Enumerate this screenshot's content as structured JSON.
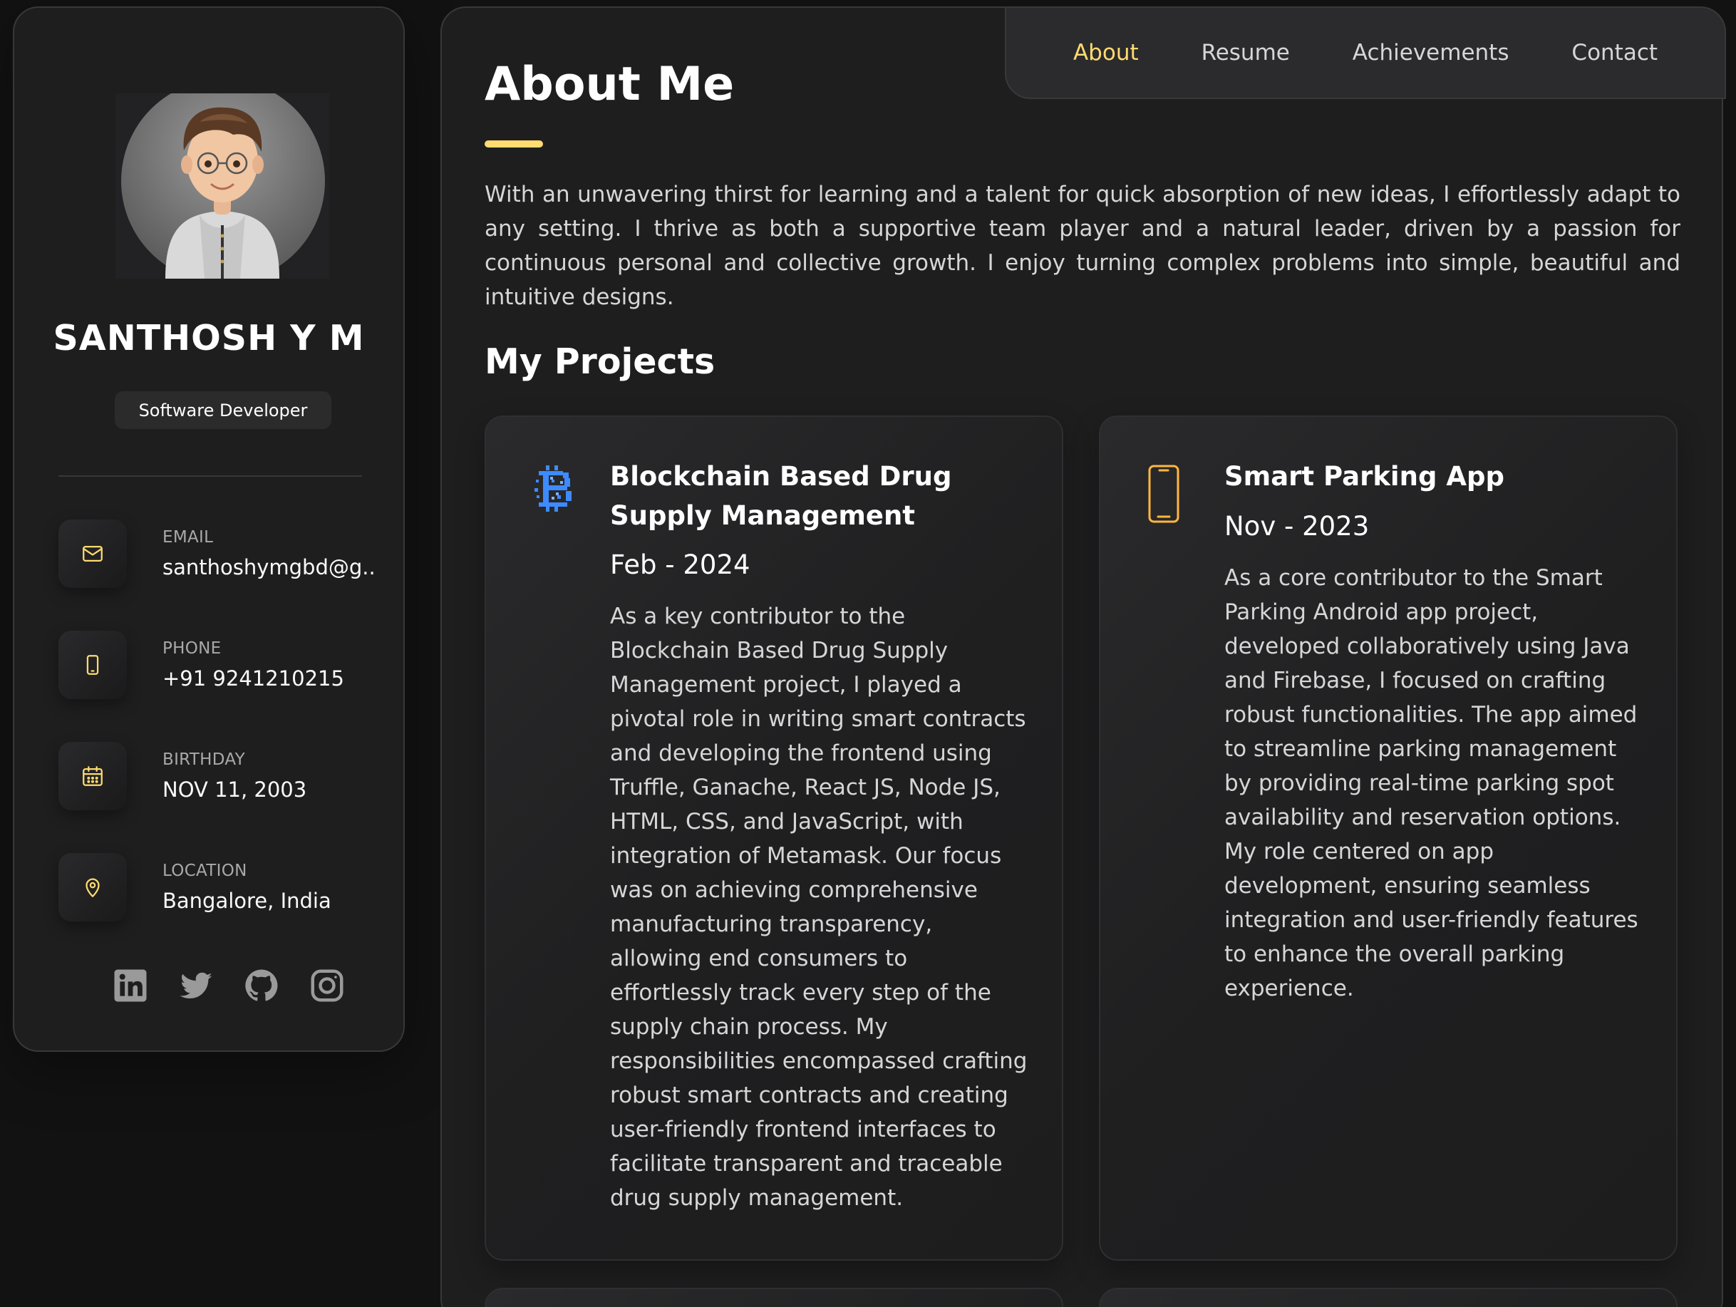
{
  "profile": {
    "name": "SANTHOSH Y M",
    "role": "Software Developer"
  },
  "contacts": [
    {
      "label": "EMAIL",
      "value": "santhoshymgbd@g...",
      "icon": "mail-icon"
    },
    {
      "label": "PHONE",
      "value": "+91 9241210215",
      "icon": "phone-icon"
    },
    {
      "label": "BIRTHDAY",
      "value": "NOV 11, 2003",
      "icon": "calendar-icon"
    },
    {
      "label": "LOCATION",
      "value": "Bangalore, India",
      "icon": "location-icon"
    }
  ],
  "socials": [
    "linkedin-icon",
    "twitter-icon",
    "github-icon",
    "instagram-icon"
  ],
  "nav": {
    "items": [
      "About",
      "Resume",
      "Achievements",
      "Contact"
    ],
    "active": "About"
  },
  "about": {
    "title": "About Me",
    "text": "With an unwavering thirst for learning and a talent for quick absorption of new ideas, I effortlessly adapt to any setting. I thrive as both a supportive team player and a natural leader, driven by a passion for continuous personal and collective growth. I enjoy turning complex problems into simple, beautiful and intuitive designs."
  },
  "projects": {
    "title": "My Projects",
    "items": [
      {
        "title": "Blockchain Based Drug Supply Management",
        "date": "Feb - 2024",
        "icon": "blockchain-icon",
        "description": "As a key contributor to the Blockchain Based Drug Supply Management project, I played a pivotal role in writing smart contracts and developing the frontend using Truffle, Ganache, React JS, Node JS, HTML, CSS, and JavaScript, with integration of Metamask. Our focus was on achieving comprehensive manufacturing transparency, allowing end consumers to effortlessly track every step of the supply chain process. My responsibilities encompassed crafting robust smart contracts and creating user-friendly frontend interfaces to facilitate transparent and traceable drug supply management."
      },
      {
        "title": "Smart Parking App",
        "date": "Nov - 2023",
        "icon": "smartphone-icon",
        "description": "As a core contributor to the Smart Parking Android app project, developed collaboratively using Java and Firebase, I focused on crafting robust functionalities. The app aimed to streamline parking management by providing real-time parking spot availability and reservation options. My role centered on app development, ensuring seamless integration and user-friendly features to enhance the overall parking experience."
      }
    ]
  },
  "colors": {
    "accent": "#ffdb70",
    "background": "#121212",
    "panel": "#1e1e1f",
    "blockchain_blue": "#3d8bff"
  }
}
